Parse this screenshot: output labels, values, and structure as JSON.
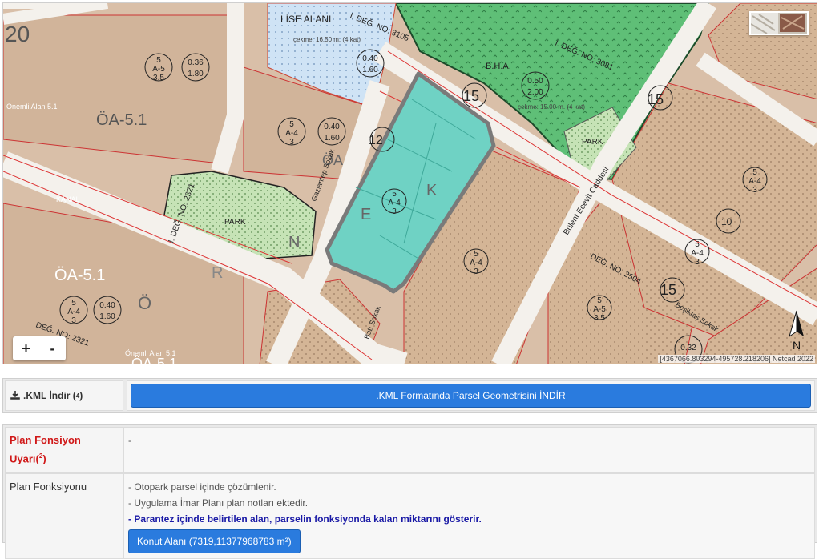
{
  "map": {
    "scale_coords": "[4367066.803294-495728.218206] Netcad 2022",
    "north_label": "N",
    "zoom_in": "+",
    "zoom_out": "-",
    "labels": {
      "oa51_top": "ÖA-5.1",
      "oa51_left": "ÖA-5.1",
      "oa51_bottom": "ÖA-5.1",
      "oa_mid": "ÖA",
      "onemli1": "Önemli Alan 5.1",
      "onemli2": "Önemli Alan 5.1",
      "park1": "PARK",
      "park2": "PARK",
      "lise": "LİSE ALANI",
      "bha": "B.H.A.",
      "kanal": "KANAL",
      "cekme1": "çekme: 16.50 m. (4 kat)",
      "cekme2": "çekme: 15.00 m. (4 kat)",
      "deg1": "I. DEĞ. NO: 3105",
      "deg2": "I. DEĞ. NO: 3081",
      "deg3": "I. DEĞ. NO: 2321",
      "deg4": "DEĞ. NO: 2321",
      "deg5": "DEĞ. NO: 2504",
      "street1": "Gaziantep Sokak",
      "street2": "Bülent Ecevit Caddesi",
      "street3": "Beşiktaş Sokak",
      "street4": "Batı Sokak",
      "num20": "20",
      "num15a": "15",
      "num15b": "15",
      "num15c": "15",
      "num12": "12",
      "num10": "10",
      "r_036": "0.36",
      "r_180": "1.80",
      "r_040a": "0.40",
      "r_160a": "1.60",
      "r_040b": "0.40",
      "r_160b": "1.60",
      "r_040c": "0.40",
      "r_160c": "1.60",
      "r_050": "0.50",
      "r_200": "2.00",
      "r_032": "0.32",
      "z_a5": "A-5",
      "z_a4": "A-4",
      "z_5": "5",
      "z_35": "3.5",
      "z_3": "3",
      "letter_e": "E",
      "letter_k": "K",
      "letter_n": "N",
      "letter_r": "R",
      "letter_o": "Ö"
    }
  },
  "kml": {
    "label": ".KML İndir (",
    "label_sup": "4",
    "label_close": ")",
    "button": ".KML Formatında Parsel Geometrisini İNDİR"
  },
  "plan": {
    "warning_label": "Plan Fonsiyon Uyarı(",
    "warning_sup": "2",
    "warning_close": ")",
    "warning_value": "-",
    "function_label": "Plan Fonksiyonu",
    "lines": [
      "- Otopark parsel içinde çözümlenir.",
      "- Uygulama İmar Planı plan notları ektedir."
    ],
    "note": "- Parantez içinde belirtilen alan, parselin fonksiyonda kalan miktarını gösterir.",
    "area_button": "Konut Alanı (7319,11377968783 m²)"
  },
  "colors": {
    "accent_button": "#2a7bde",
    "parcel_fill": "#6fd2c4",
    "warning_text": "#d01818",
    "note_text": "#1a1aa6",
    "park_green": "#b8dca6",
    "school_blue": "#c9dff2",
    "dark_green": "#5fbf77",
    "residential_tan": "#d6b89c"
  }
}
